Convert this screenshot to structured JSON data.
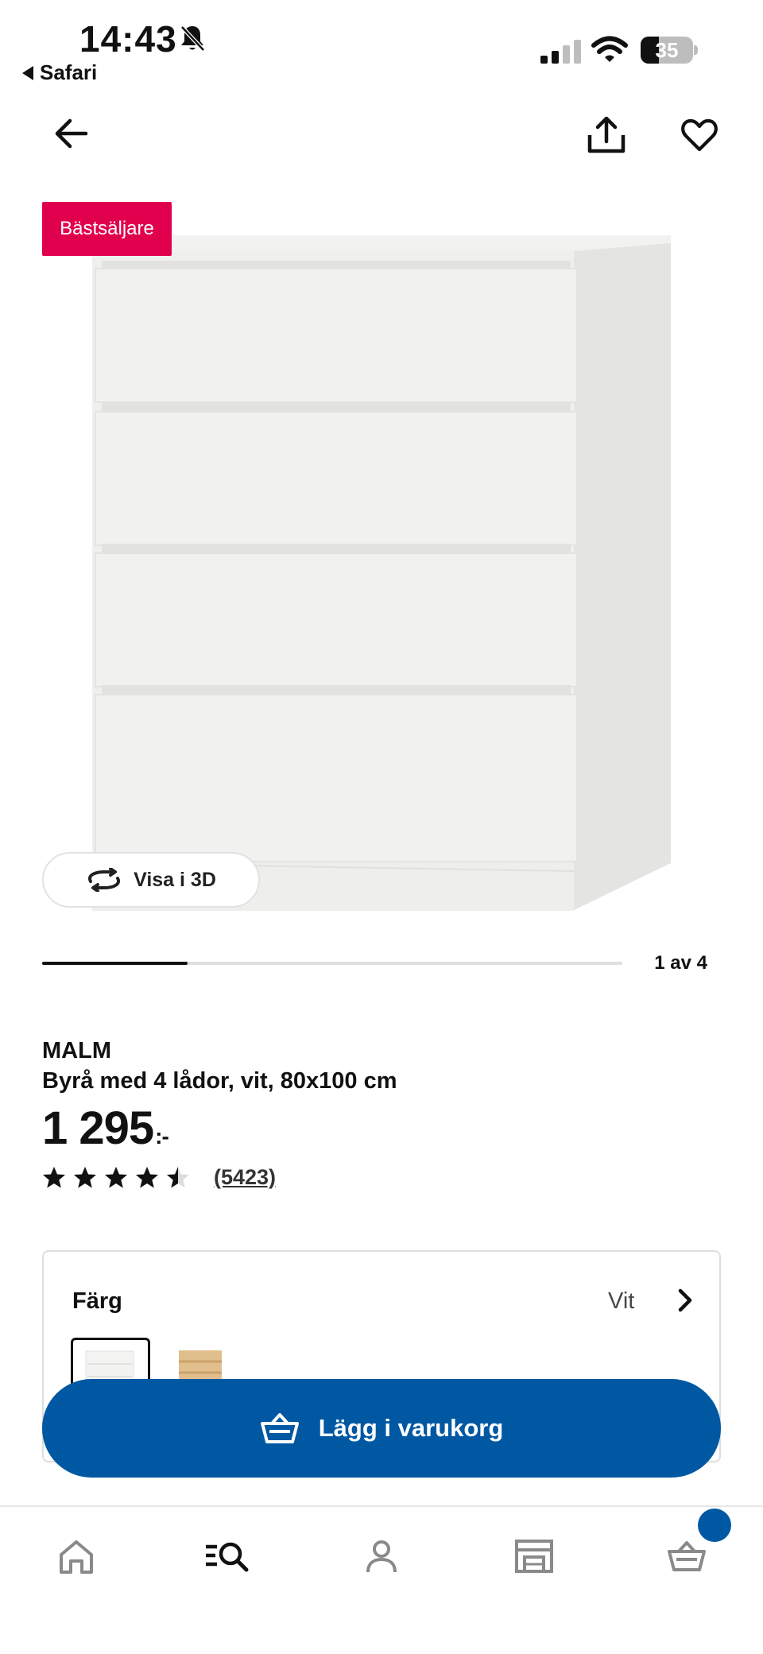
{
  "status_bar": {
    "time": "14:43",
    "back_app": "Safari",
    "battery_level": "35",
    "battery_fraction": 0.35
  },
  "product": {
    "badge": "Bästsäljare",
    "view_3d_label": "Visa i 3D",
    "image_counter": "1 av 4",
    "carousel_progress": 0.25,
    "brand": "MALM",
    "description": "Byrå med 4 lådor, vit, 80x100 cm",
    "price": "1 295",
    "price_suffix": ":-",
    "rating": 4.5,
    "rating_count": "(5423)"
  },
  "color_selector": {
    "label": "Färg",
    "value": "Vit",
    "options": [
      "white-dresser-swatch",
      "oak-dresser-swatch"
    ]
  },
  "add_to_cart": {
    "label": "Lägg i varukorg"
  },
  "tabbar": {
    "items": [
      "home-icon",
      "search-icon",
      "profile-icon",
      "store-icon",
      "cart-icon"
    ]
  },
  "colors": {
    "badge": "#e0004d",
    "primary_blue": "#0058a3",
    "text": "#111111"
  }
}
